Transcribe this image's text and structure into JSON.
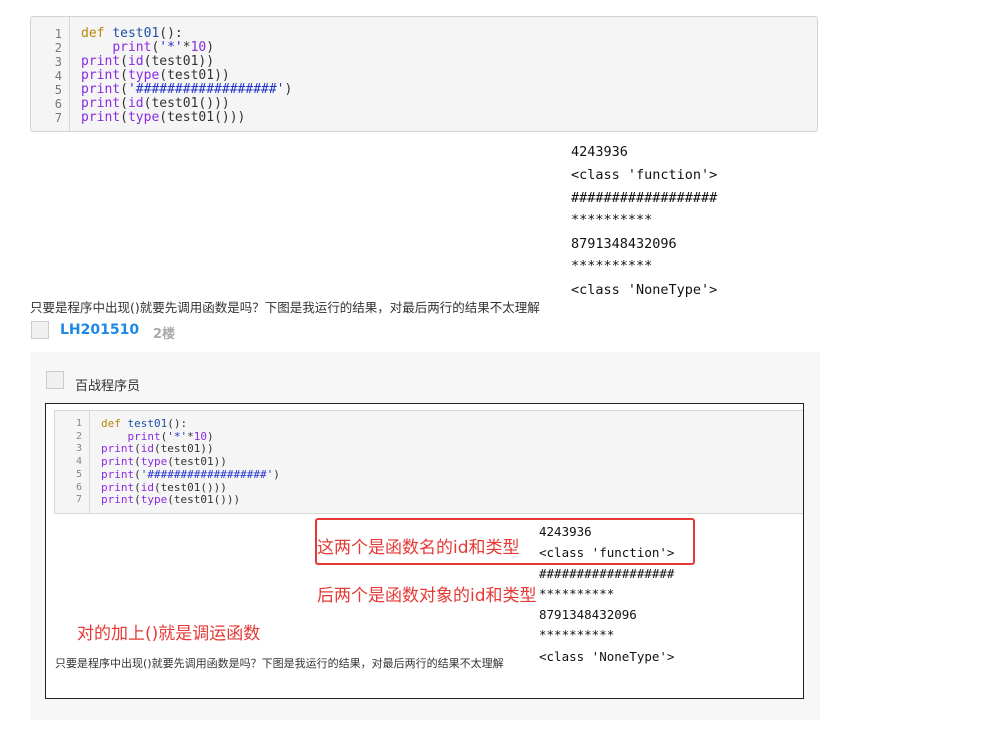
{
  "code_block": {
    "line_numbers": [
      "1",
      "2",
      "3",
      "4",
      "5",
      "6",
      "7"
    ],
    "lines": [
      [
        {
          "t": "def ",
          "c": "kw"
        },
        {
          "t": "test01",
          "c": "fn"
        },
        {
          "t": "():",
          "c": ""
        }
      ],
      [
        {
          "t": "    ",
          "c": ""
        },
        {
          "t": "print",
          "c": "bi"
        },
        {
          "t": "(",
          "c": ""
        },
        {
          "t": "'*'",
          "c": "str"
        },
        {
          "t": "*",
          "c": ""
        },
        {
          "t": "10",
          "c": "num"
        },
        {
          "t": ")",
          "c": ""
        }
      ],
      [
        {
          "t": "print",
          "c": "bi"
        },
        {
          "t": "(",
          "c": ""
        },
        {
          "t": "id",
          "c": "bi"
        },
        {
          "t": "(test01))",
          "c": ""
        }
      ],
      [
        {
          "t": "print",
          "c": "bi"
        },
        {
          "t": "(",
          "c": ""
        },
        {
          "t": "type",
          "c": "bi"
        },
        {
          "t": "(test01))",
          "c": ""
        }
      ],
      [
        {
          "t": "print",
          "c": "bi"
        },
        {
          "t": "(",
          "c": ""
        },
        {
          "t": "'##################'",
          "c": "str"
        },
        {
          "t": ")",
          "c": ""
        }
      ],
      [
        {
          "t": "print",
          "c": "bi"
        },
        {
          "t": "(",
          "c": ""
        },
        {
          "t": "id",
          "c": "bi"
        },
        {
          "t": "(test01()))",
          "c": ""
        }
      ],
      [
        {
          "t": "print",
          "c": "bi"
        },
        {
          "t": "(",
          "c": ""
        },
        {
          "t": "type",
          "c": "bi"
        },
        {
          "t": "(test01()))",
          "c": ""
        }
      ]
    ]
  },
  "output_lines": [
    "4243936",
    "<class 'function'>",
    "##################",
    "**********",
    "8791348432096",
    "**********",
    "<class 'NoneType'>"
  ],
  "question_text": "只要是程序中出现()就要先调用函数是吗？下图是我运行的结果，对最后两行的结果不太理解",
  "post": {
    "username": "LH201510",
    "floor": "2楼"
  },
  "reply": {
    "author": "百战程序员",
    "annotations": {
      "name_id_type": "这两个是函数名的id和类型",
      "object_id_type": "后两个是函数对象的id和类型",
      "call_note": "对的加上()就是调运函数"
    }
  },
  "colors": {
    "link_blue": "#1e88e5",
    "annotation_red": "#e53935"
  }
}
